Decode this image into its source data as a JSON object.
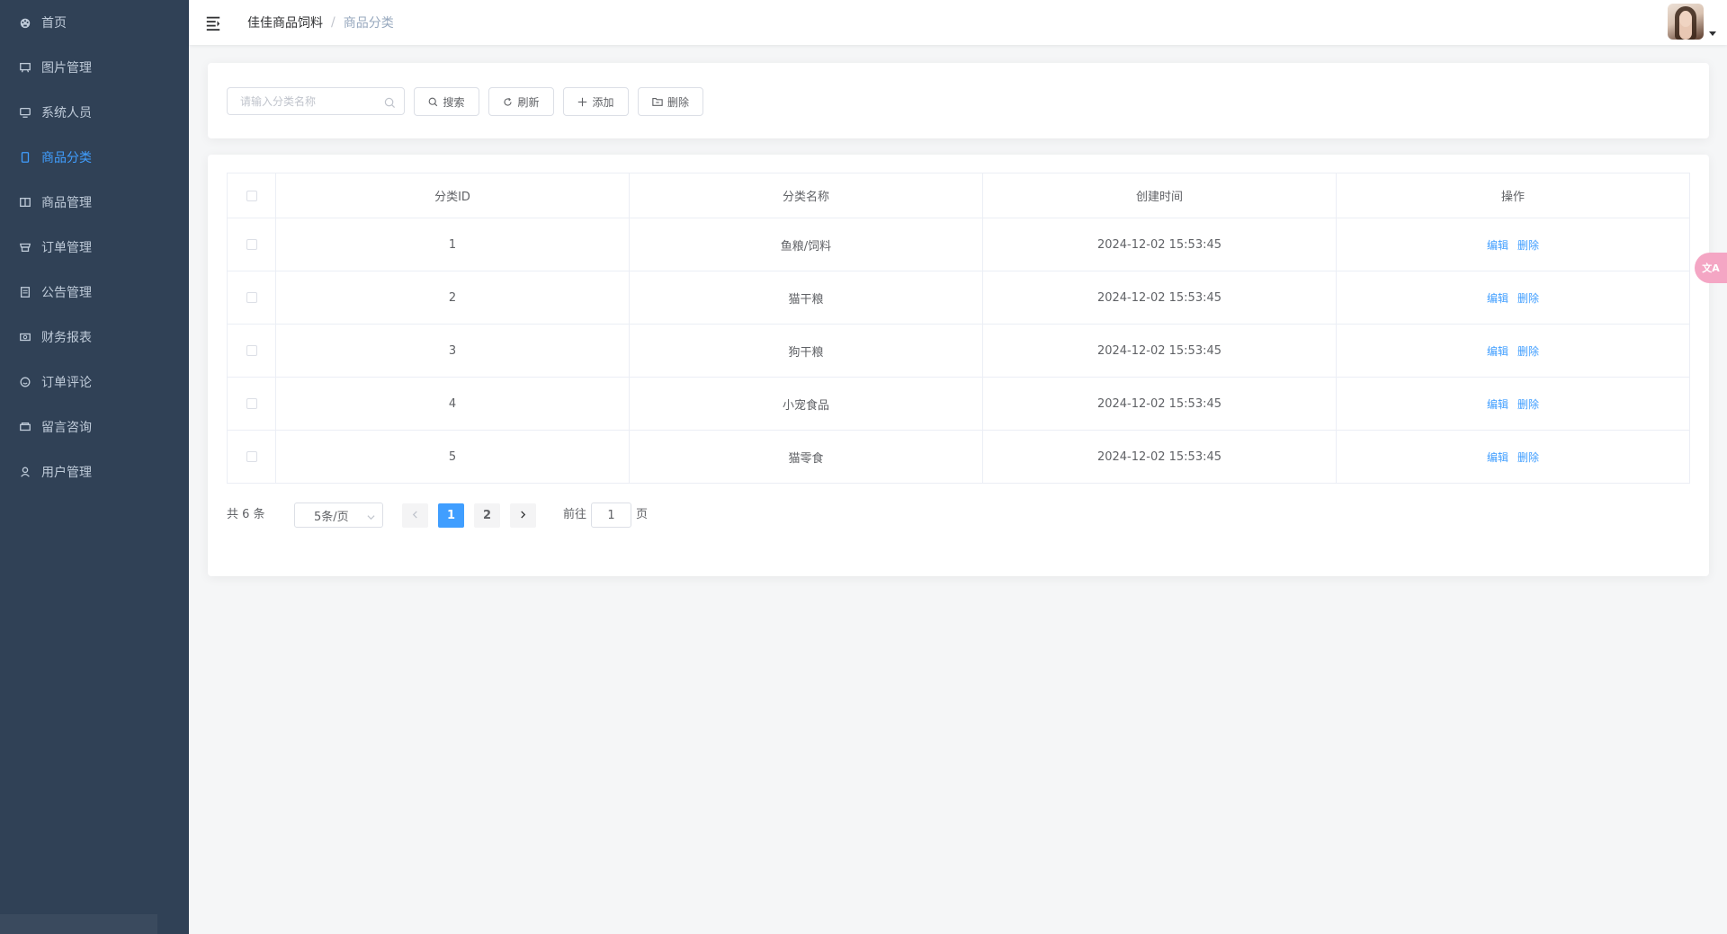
{
  "sidebar": {
    "items": [
      {
        "label": "首页",
        "icon": "dashboard-icon"
      },
      {
        "label": "图片管理",
        "icon": "picture-icon"
      },
      {
        "label": "系统人员",
        "icon": "monitor-icon"
      },
      {
        "label": "商品分类",
        "icon": "document-icon"
      },
      {
        "label": "商品管理",
        "icon": "notebook-icon"
      },
      {
        "label": "订单管理",
        "icon": "shop-icon"
      },
      {
        "label": "公告管理",
        "icon": "tickets-icon"
      },
      {
        "label": "财务报表",
        "icon": "money-icon"
      },
      {
        "label": "订单评论",
        "icon": "chat-icon"
      },
      {
        "label": "留言咨询",
        "icon": "message-icon"
      },
      {
        "label": "用户管理",
        "icon": "user-icon"
      }
    ],
    "active_index": 3,
    "active_color": "#409eff"
  },
  "header": {
    "breadcrumb": [
      "佳佳商品饲料",
      "商品分类"
    ],
    "separator": "/"
  },
  "search": {
    "placeholder": "请输入分类名称",
    "search_label": "搜索",
    "refresh_label": "刷新",
    "add_label": "添加",
    "delete_label": "删除"
  },
  "table": {
    "columns": [
      "分类ID",
      "分类名称",
      "创建时间",
      "操作"
    ],
    "rows": [
      {
        "id": "1",
        "name": "鱼粮/饲料",
        "created": "2024-12-02 15:53:45"
      },
      {
        "id": "2",
        "name": "猫干粮",
        "created": "2024-12-02 15:53:45"
      },
      {
        "id": "3",
        "name": "狗干粮",
        "created": "2024-12-02 15:53:45"
      },
      {
        "id": "4",
        "name": "小宠食品",
        "created": "2024-12-02 15:53:45"
      },
      {
        "id": "5",
        "name": "猫零食",
        "created": "2024-12-02 15:53:45"
      }
    ],
    "edit_label": "编辑",
    "delete_label": "删除"
  },
  "pagination": {
    "total": "共 6 条",
    "page_size": "5条/页",
    "pages": [
      "1",
      "2"
    ],
    "current": "1",
    "goto_label": "前往",
    "goto_value": "1",
    "goto_unit": "页"
  },
  "float_button": {
    "label": "文A"
  }
}
